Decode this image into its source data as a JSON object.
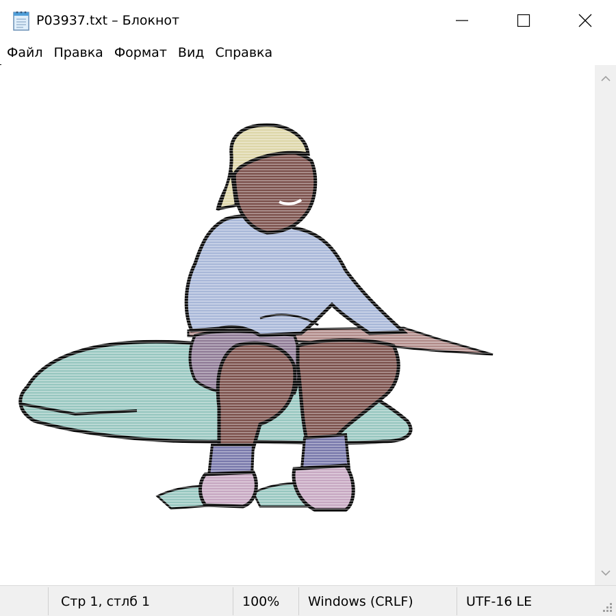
{
  "window": {
    "title": "P03937.txt – Блокнот",
    "icon": "notepad-icon",
    "controls": {
      "minimize": "minimize-icon",
      "maximize": "maximize-icon",
      "close": "close-icon"
    }
  },
  "menu": {
    "items": [
      {
        "label": "Файл"
      },
      {
        "label": "Правка"
      },
      {
        "label": "Формат"
      },
      {
        "label": "Вид"
      },
      {
        "label": "Справка"
      }
    ]
  },
  "editor": {
    "content": "ASCII-art illustration of a smiling child in a cap sitting on a rock holding a stick",
    "art_colors": {
      "outline": "#000000",
      "cap": "#ddd6a8",
      "skin": "#7a4f4a",
      "sweater": "#a8b7d8",
      "shorts": "#8e7a95",
      "rock": "#96c6bf",
      "socks": "#7777aa",
      "shoes": "#c6a7c1",
      "stick": "#b08a88"
    }
  },
  "statusbar": {
    "position": "Стр 1, стлб 1",
    "zoom": "100%",
    "line_ending": "Windows (CRLF)",
    "encoding": "UTF-16 LE"
  },
  "colors": {
    "chrome": "#f0f0f0",
    "background": "#ffffff",
    "text": "#000000"
  }
}
